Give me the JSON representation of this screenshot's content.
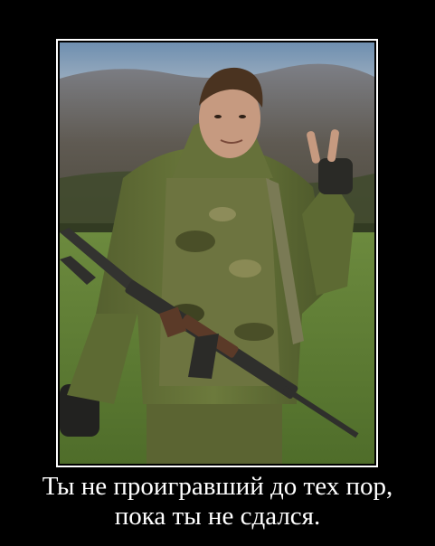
{
  "poster": {
    "caption": {
      "line1": "Ты не проигравший до тех пор,",
      "line2": "пока ты не сдался."
    },
    "colors": {
      "background": "#000000",
      "frame": "#ffffff",
      "caption_text": "#ffffff"
    }
  }
}
